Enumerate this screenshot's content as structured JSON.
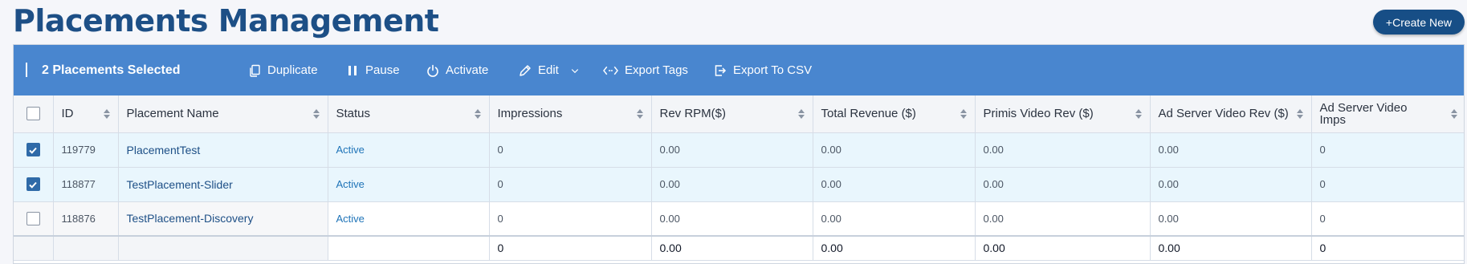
{
  "page": {
    "title": "Placements Management",
    "create_button": "+Create New"
  },
  "toolbar": {
    "selected_label": "2 Placements Selected",
    "actions": {
      "duplicate": "Duplicate",
      "pause": "Pause",
      "activate": "Activate",
      "edit": "Edit",
      "export_tags": "Export Tags",
      "export_csv": "Export To CSV"
    },
    "icons": [
      "duplicate-icon",
      "pause-icon",
      "power-icon",
      "pencil-icon",
      "chevron-down-icon",
      "code-tags-icon",
      "export-icon"
    ]
  },
  "table": {
    "columns": {
      "id": "ID",
      "name": "Placement Name",
      "status": "Status",
      "impressions": "Impressions",
      "rev_rpm": "Rev RPM($)",
      "total_revenue": "Total Revenue ($)",
      "primis_video_rev": "Primis Video Rev ($)",
      "ad_server_video_rev": "Ad Server Video Rev ($)",
      "ad_server_video_imps": "Ad Server Video Imps"
    },
    "rows": [
      {
        "checked": true,
        "id": "119779",
        "name": "PlacementTest",
        "status": "Active",
        "impressions": "0",
        "rev_rpm": "0.00",
        "total_revenue": "0.00",
        "primis_video_rev": "0.00",
        "ad_server_video_rev": "0.00",
        "ad_server_video_imps": "0"
      },
      {
        "checked": true,
        "id": "118877",
        "name": "TestPlacement-Slider",
        "status": "Active",
        "impressions": "0",
        "rev_rpm": "0.00",
        "total_revenue": "0.00",
        "primis_video_rev": "0.00",
        "ad_server_video_rev": "0.00",
        "ad_server_video_imps": "0"
      },
      {
        "checked": false,
        "id": "118876",
        "name": "TestPlacement-Discovery",
        "status": "Active",
        "impressions": "0",
        "rev_rpm": "0.00",
        "total_revenue": "0.00",
        "primis_video_rev": "0.00",
        "ad_server_video_rev": "0.00",
        "ad_server_video_imps": "0"
      }
    ],
    "totals": {
      "impressions": "0",
      "rev_rpm": "0.00",
      "total_revenue": "0.00",
      "primis_video_rev": "0.00",
      "ad_server_video_rev": "0.00",
      "ad_server_video_imps": "0"
    }
  },
  "colors": {
    "title": "#1d4f86",
    "toolbar_bg": "#4986cf",
    "create_button_bg": "#174e86",
    "selected_row_bg": "#e9f6fd",
    "checkbox_checked": "#2f6aa8",
    "status_active": "#1f74b8"
  }
}
